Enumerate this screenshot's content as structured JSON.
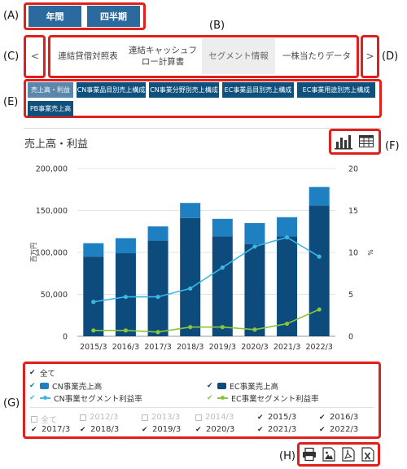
{
  "markers": [
    "(A)",
    "(B)",
    "(C)",
    "(D)",
    "(E)",
    "(F)",
    "(G)",
    "(H)"
  ],
  "period_buttons": [
    "年間",
    "四半期"
  ],
  "nav": {
    "prev": "<",
    "next": ">"
  },
  "tabs": [
    "連結貸借対照表",
    "連結キャッシュフロー計算書",
    "セグメント情報",
    "一株当たりデータ"
  ],
  "subtabs": [
    "売上高・利益",
    "CN事業品目別売上構成",
    "CN事業分野別売上構成",
    "EC事業品目別売上構成",
    "EC事業用途別売上構成",
    "PB事業売上高"
  ],
  "chart_title": "売上高・利益",
  "view_icons": [
    "bar-chart-icon",
    "table-icon"
  ],
  "chart_data": {
    "type": "bar",
    "categories": [
      "2015/3",
      "2016/3",
      "2017/3",
      "2018/3",
      "2019/3",
      "2020/3",
      "2021/3",
      "2022/3"
    ],
    "series": [
      {
        "name": "CN事業売上高",
        "kind": "bar",
        "values": [
          16000,
          18000,
          17000,
          18000,
          21000,
          25000,
          23000,
          22000
        ],
        "color": "#1e7fc1"
      },
      {
        "name": "EC事業売上高",
        "kind": "bar",
        "values": [
          95000,
          99000,
          114000,
          141000,
          119000,
          110000,
          119000,
          156000
        ],
        "color": "#0d4b7c"
      },
      {
        "name": "CN事業セグメント利益率",
        "kind": "line",
        "values": [
          4.1,
          4.7,
          4.7,
          5.7,
          8.2,
          10.7,
          11.8,
          9.5
        ],
        "color": "#3db8e6"
      },
      {
        "name": "EC事業セグメント利益率",
        "kind": "line",
        "values": [
          0.7,
          0.7,
          0.5,
          1.1,
          1.1,
          0.8,
          1.5,
          3.2
        ],
        "color": "#8cc43c"
      }
    ],
    "ylabel": "百万円",
    "y2label": "%",
    "ylim": [
      0,
      200000
    ],
    "y2lim": [
      0,
      20
    ],
    "yticks": [
      "0",
      "50,000",
      "100,000",
      "150,000",
      "200,000"
    ],
    "y2ticks": [
      "0",
      "5",
      "10",
      "15",
      "20"
    ],
    "grid": true
  },
  "legend": {
    "all_label": "全て",
    "items": [
      "CN事業売上高",
      "EC事業売上高",
      "CN事業セグメント利益率",
      "EC事業セグメント利益率"
    ]
  },
  "years": {
    "all_label": "全て",
    "items": [
      {
        "label": "2012/3",
        "checked": false
      },
      {
        "label": "2013/3",
        "checked": false
      },
      {
        "label": "2014/3",
        "checked": false
      },
      {
        "label": "2015/3",
        "checked": true
      },
      {
        "label": "2016/3",
        "checked": true
      },
      {
        "label": "2017/3",
        "checked": true
      },
      {
        "label": "2018/3",
        "checked": true
      },
      {
        "label": "2019/3",
        "checked": true
      },
      {
        "label": "2020/3",
        "checked": true
      },
      {
        "label": "2021/3",
        "checked": true
      },
      {
        "label": "2022/3",
        "checked": true
      }
    ]
  },
  "export_icons": [
    "print-icon",
    "image-icon",
    "pdf-icon",
    "excel-icon"
  ]
}
